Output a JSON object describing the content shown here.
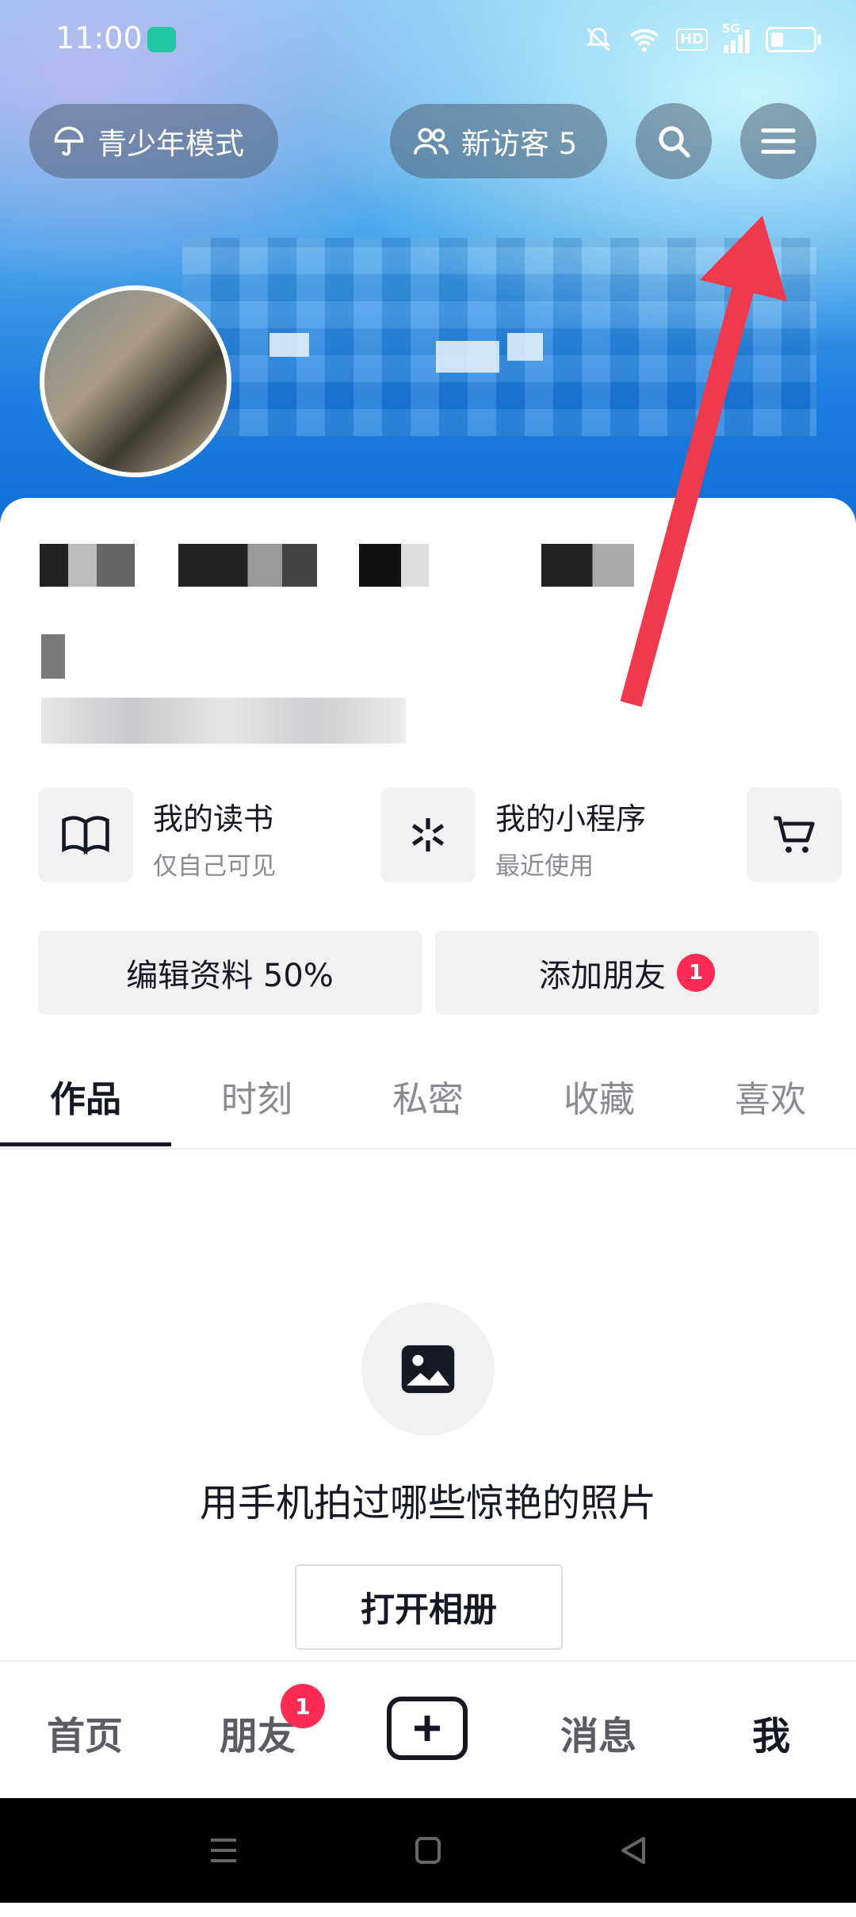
{
  "status_bar": {
    "time": "11:00",
    "hd": "HD",
    "network": "5G",
    "battery_level": 0.3,
    "icons": [
      "silent-icon",
      "wifi-icon",
      "signal-icon",
      "battery-icon"
    ]
  },
  "top_bar": {
    "teen_mode_label": "青少年模式",
    "visitors_label": "新访客 5",
    "icons": [
      "umbrella-icon",
      "people-icon",
      "search-icon",
      "menu-icon"
    ]
  },
  "services": [
    {
      "title": "我的读书",
      "subtitle": "仅自己可见",
      "icon": "book-icon"
    },
    {
      "title": "我的小程序",
      "subtitle": "最近使用",
      "icon": "mini-program-icon"
    },
    {
      "title": "",
      "subtitle": "",
      "icon": "cart-icon"
    }
  ],
  "actions": {
    "edit_profile": "编辑资料 50%",
    "add_friends": "添加朋友",
    "add_friends_badge": "1"
  },
  "tabs": [
    "作品",
    "时刻",
    "私密",
    "收藏",
    "喜欢"
  ],
  "active_tab": "作品",
  "empty_state": {
    "icon": "image-icon",
    "text": "用手机拍过哪些惊艳的照片",
    "button": "打开相册"
  },
  "bottom_nav": {
    "items": [
      "首页",
      "朋友",
      "消息",
      "我"
    ],
    "friends_badge": "1",
    "active": "我"
  },
  "colors": {
    "accent": "#fe2c55",
    "arrow": "#ee3a4c",
    "text": "#161823",
    "muted": "#8a8b91"
  }
}
